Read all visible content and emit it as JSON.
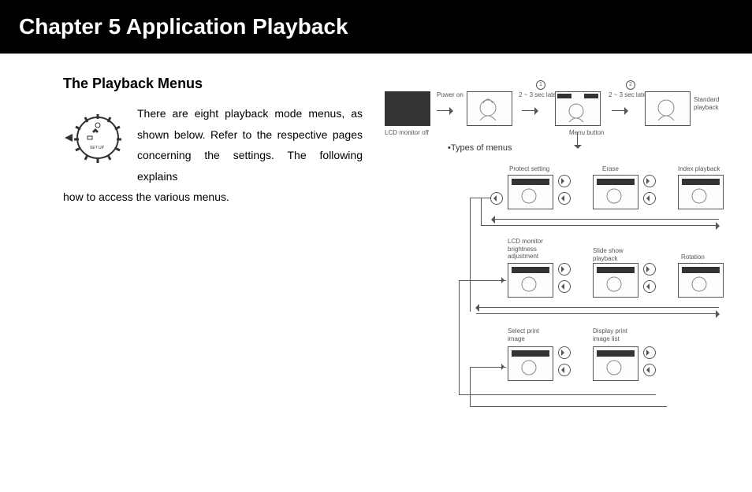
{
  "chapter_title": "Chapter 5   Application Playback",
  "section_title": "The Playback Menus",
  "body_1": "There are eight playback mode menus, as shown below. Refer to the respective pages concerning the settings. The following explains",
  "body_2": "how to access the various menus.",
  "diagram": {
    "power_on": "Power on",
    "lcd_off": "LCD monitor off",
    "wait_a": "2 ~ 3 sec later.",
    "wait_b": "2 ~ 3 sec later.",
    "menu_button": "Menu button",
    "standard_playback": "Standard\nplayback",
    "types_of_menus": "•Types of menus",
    "step1": "1",
    "step2": "2",
    "menus": {
      "protect": "Protect setting",
      "erase": "Erase",
      "index": "Index playback",
      "lcd_bright": "LCD monitor\nbrightness\nadjustment",
      "slide": "Slide show\nplayback",
      "rotation": "Rotation",
      "select_print": "Select print\nimage",
      "display_print": "Display print\nimage list"
    }
  }
}
